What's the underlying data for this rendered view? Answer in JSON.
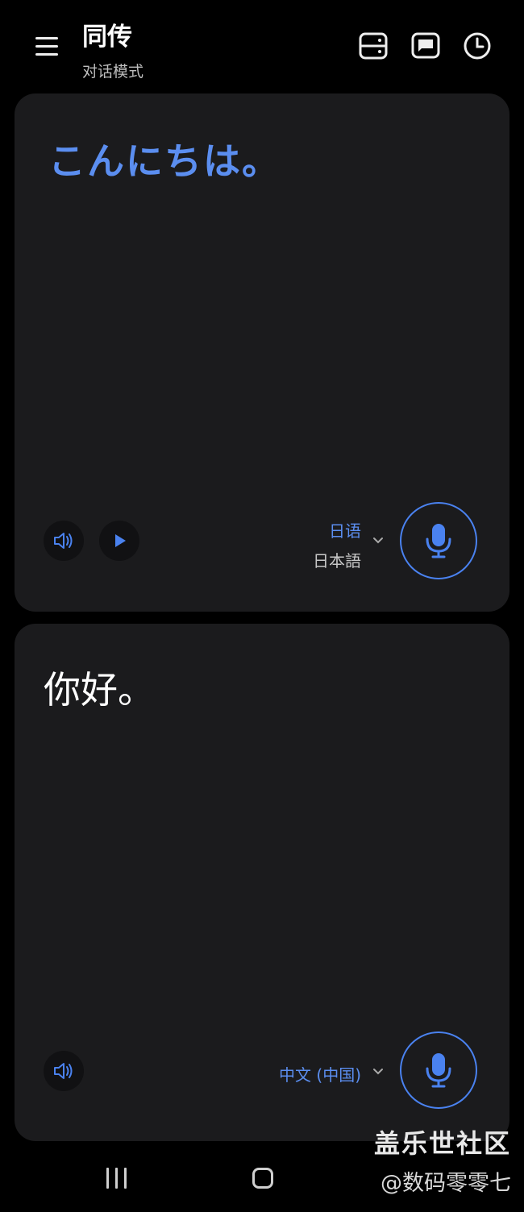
{
  "header": {
    "title": "同传",
    "subtitle": "对话模式",
    "icons": [
      "split-view-icon",
      "chat-bubble-icon",
      "history-clock-icon"
    ]
  },
  "top_panel": {
    "text": "こんにちは。",
    "lang_primary": "日语",
    "lang_secondary": "日本語",
    "text_color": "#5b8ef0"
  },
  "bottom_panel": {
    "text": "你好。",
    "lang_primary": "中文 (中国)"
  },
  "watermark": {
    "line1": "盖乐世社区",
    "line2": "@数码零零七"
  },
  "colors": {
    "accent": "#4a82f0",
    "background": "#000000",
    "card": "#1b1b1d"
  }
}
